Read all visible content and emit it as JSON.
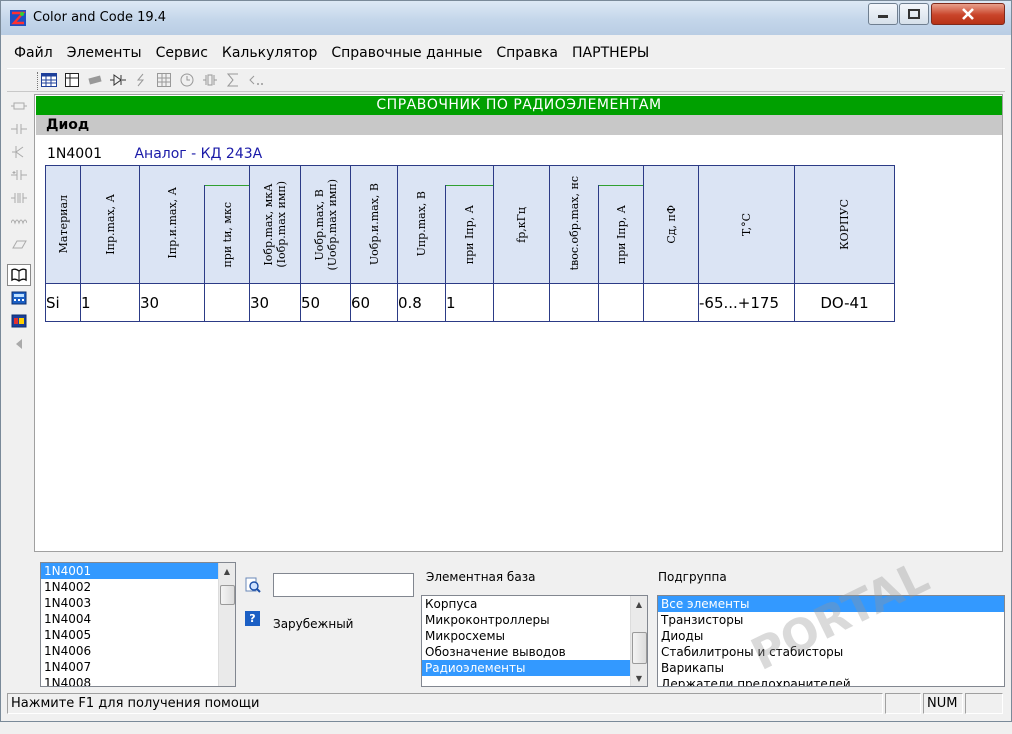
{
  "window": {
    "title": "Color and Code 19.4"
  },
  "menu": [
    "Файл",
    "Элементы",
    "Сервис",
    "Калькулятор",
    "Справочные данные",
    "Справка",
    "ПАРТНЕРЫ"
  ],
  "content": {
    "header": "СПРАВОЧНИК ПО РАДИОЭЛЕМЕНТАМ",
    "category": "Диод",
    "part_number": "1N4001",
    "analog": "Аналог - КД 243А",
    "table": {
      "headers": {
        "material": "Материал",
        "ipr_max": "Iпр.max, А",
        "ipr_i_max": "Iпр.и.max, А",
        "at_t_i": "при tи, мкс",
        "iobr_max": "Iобр.max, мкА",
        "iobr_max_sub": "(Iобр.max имп)",
        "uobr_max": "Uобр.max, В",
        "uobr_max_sub": "(Uобр.max имп)",
        "uobr_i_max": "Uобр.и.max, В",
        "upr_max": "Uпр.max, В",
        "at_ipr": "при Iпр, А",
        "f_r": "fр,кГц",
        "t_vos": "tвос.обр.max, нс",
        "at_ipr2": "при Iпр, А",
        "cd": "Сд, пФ",
        "temp": "T,°C",
        "case": "КОРПУС"
      },
      "values": {
        "material": "Si",
        "ipr_max": "1",
        "ipr_i_max": "30",
        "at_t_i": "",
        "iobr_max": "30",
        "uobr_max": "50",
        "uobr_i_max": "60",
        "upr_max": "0.8",
        "at_ipr": "1",
        "f_r": "",
        "t_vos": "",
        "at_ipr2": "",
        "cd": "",
        "temp": "-65...+175",
        "case": "DO-41"
      }
    }
  },
  "bottom": {
    "part_list": [
      "1N4001",
      "1N4002",
      "1N4003",
      "1N4004",
      "1N4005",
      "1N4006",
      "1N4007",
      "1N4008"
    ],
    "part_list_selected": "1N4001",
    "search_value": "",
    "foreign_label": "Зарубежный",
    "element_base_label": "Элементная база",
    "element_base": [
      "Корпуса",
      "Микроконтроллеры",
      "Микросхемы",
      "Обозначение выводов",
      "Радиоэлементы"
    ],
    "element_base_selected": "Радиоэлементы",
    "subgroup_label": "Подгруппа",
    "subgroup": [
      "Все элементы",
      "Транзисторы",
      "Диоды",
      "Стабилитроны и стабисторы",
      "Варикапы",
      "Держатели предохранителей"
    ],
    "subgroup_selected": "Все элементы"
  },
  "status": {
    "help_text": "Нажмите F1 для получения помощи",
    "num": "NUM"
  },
  "watermark": "PORTAL",
  "colors": {
    "header_green": "#00a000",
    "table_header_bg": "#dbe4f4",
    "table_border": "#2c3b86",
    "selection": "#3399ff",
    "analog_text": "#1a1aa8"
  }
}
